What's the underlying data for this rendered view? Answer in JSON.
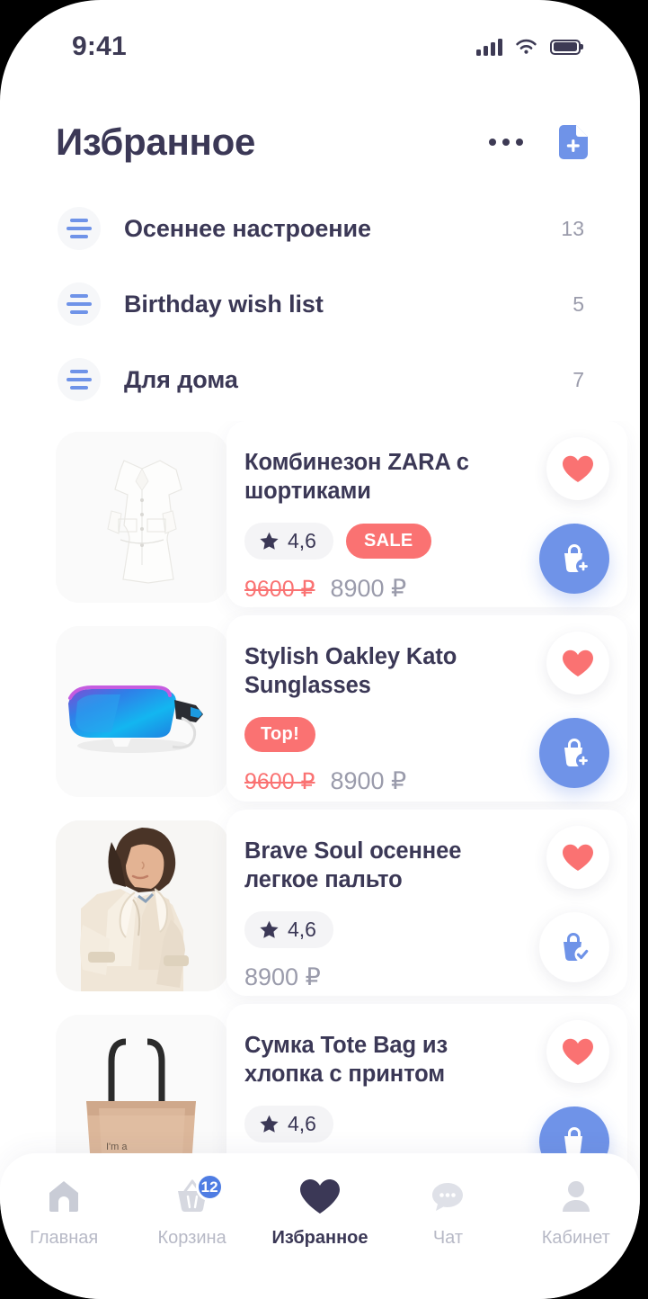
{
  "status_bar": {
    "time": "9:41",
    "signal_icon": "cellular-signal-icon",
    "wifi_icon": "wifi-icon",
    "battery_icon": "battery-full-icon"
  },
  "header": {
    "title": "Избранное",
    "more_icon": "more-options-icon",
    "add_list_icon": "file-add-icon"
  },
  "collections": [
    {
      "icon": "list-lines-icon",
      "label": "Осеннее настроение",
      "count": "13"
    },
    {
      "icon": "list-lines-icon",
      "label": "Birthday wish list",
      "count": "5"
    },
    {
      "icon": "list-lines-icon",
      "label": "Для дома",
      "count": "7"
    }
  ],
  "products": [
    {
      "name": "Комбинезон ZARA с шортиками",
      "image": "white-jumpsuit-photo",
      "rating": "4,6",
      "tag": "SALE",
      "old_price": "9600 ₽",
      "new_price": "8900 ₽",
      "favorite": true,
      "in_cart": false,
      "fav_icon": "heart-filled-icon",
      "cart_icon": "bag-add-icon"
    },
    {
      "name": "Stylish Oakley Kato Sunglasses",
      "image": "blue-sunglasses-photo",
      "rating": "",
      "tag": "Top!",
      "old_price": "9600 ₽",
      "new_price": "8900 ₽",
      "favorite": true,
      "in_cart": false,
      "fav_icon": "heart-filled-icon",
      "cart_icon": "bag-add-icon"
    },
    {
      "name": "Brave Soul осеннее легкое пальто",
      "image": "beige-coat-model-photo",
      "rating": "4,6",
      "tag": "",
      "old_price": "",
      "new_price": "8900 ₽",
      "favorite": true,
      "in_cart": true,
      "fav_icon": "heart-filled-icon",
      "cart_icon": "bag-check-icon"
    },
    {
      "name": "Сумка Tote Bag из хлопка с принтом",
      "image": "beige-tote-bag-photo",
      "rating": "4,6",
      "tag": "",
      "old_price": "",
      "new_price": "",
      "favorite": true,
      "in_cart": false,
      "fav_icon": "heart-filled-icon",
      "cart_icon": "bag-add-icon"
    }
  ],
  "bottom_nav": [
    {
      "label": "Главная",
      "icon": "home-icon",
      "active": false,
      "badge": ""
    },
    {
      "label": "Корзина",
      "icon": "basket-icon",
      "active": false,
      "badge": "12"
    },
    {
      "label": "Избранное",
      "icon": "heart-icon",
      "active": true,
      "badge": ""
    },
    {
      "label": "Чат",
      "icon": "chat-bubble-icon",
      "active": false,
      "badge": ""
    },
    {
      "label": "Кабинет",
      "icon": "user-icon",
      "active": false,
      "badge": ""
    }
  ],
  "colors": {
    "accent_blue": "#6f93e8",
    "accent_red": "#fa7272",
    "text_dark": "#3b3856",
    "text_muted": "#9a9bab",
    "surface": "#f4f4f6"
  }
}
